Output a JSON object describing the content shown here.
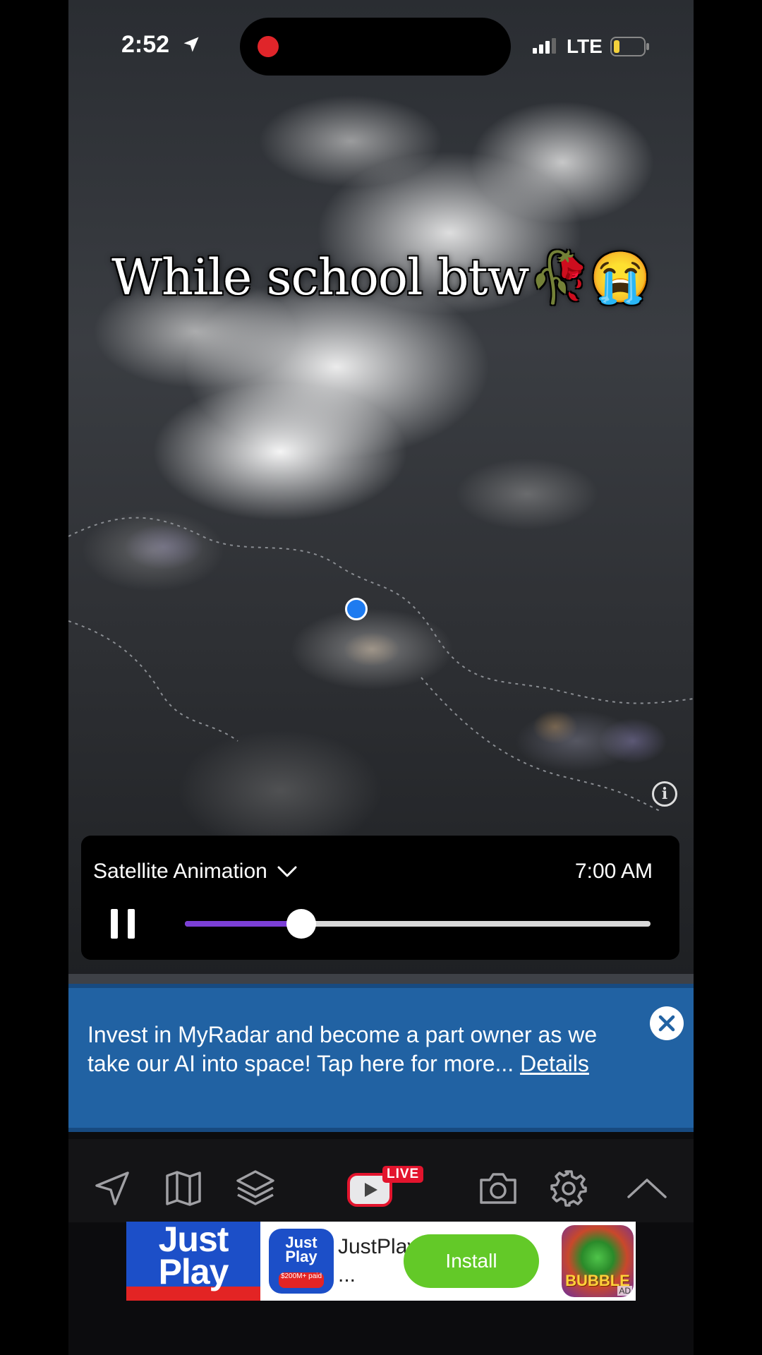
{
  "status_bar": {
    "time": "2:52",
    "network": "LTE"
  },
  "video_caption": "While school btw🥀😭",
  "animation": {
    "layer": "Satellite Animation",
    "time": "7:00 AM",
    "progress": 0.25
  },
  "promo_banner": {
    "text": "Invest in MyRadar and become a part owner as we take our AI into space!  Tap here for more...",
    "details_link": "Details"
  },
  "toolbar": {
    "live_badge": "LIVE",
    "items": [
      "location-arrow-icon",
      "map-icon",
      "layers-icon",
      "youtube-live-icon",
      "camera-icon",
      "settings-icon",
      "chevron-up-icon"
    ]
  },
  "ad": {
    "brand_text": "Just Play",
    "app_icon_text": "Just Play",
    "app_icon_sub": "$200M+ paid",
    "title": "JustPlay: ...",
    "install_label": "Install",
    "game_text": "BUBBLE",
    "badge": "AD"
  },
  "colors": {
    "promo_background": "#2162a3",
    "slider_fill": "#7b3fd6",
    "location_dot": "#1e7bf0",
    "live_badge": "#e3142d",
    "install_button": "#63c928"
  }
}
